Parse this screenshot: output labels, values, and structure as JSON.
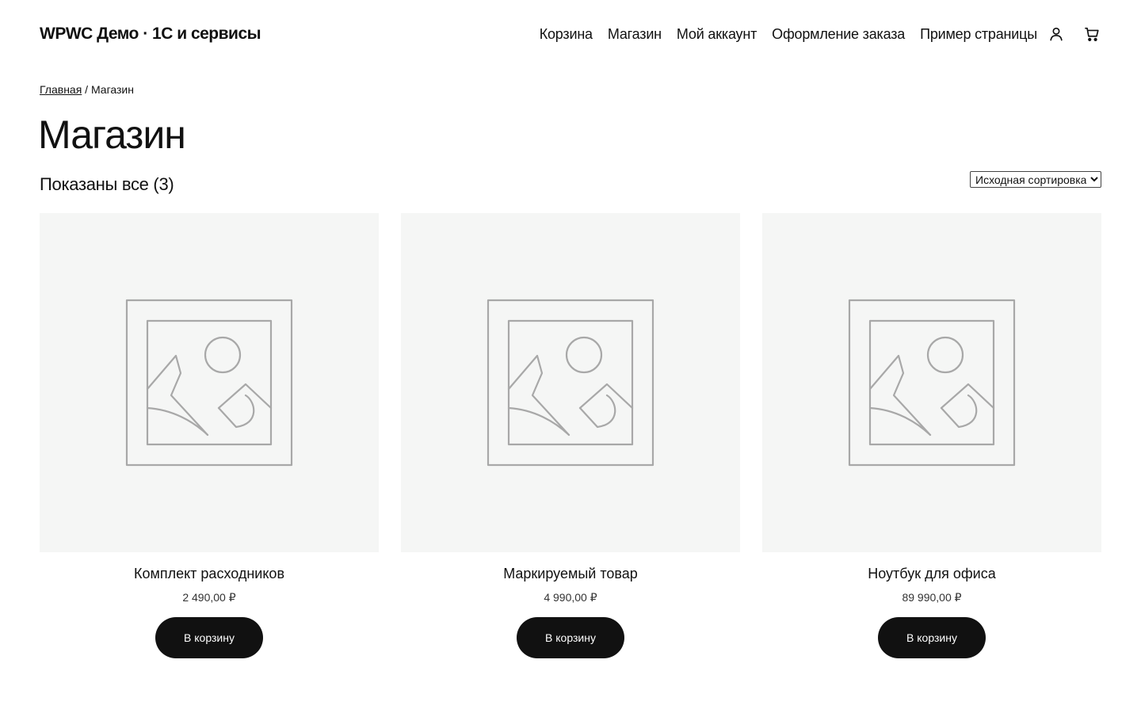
{
  "site": {
    "title": "WPWC Демо · 1С и сервисы"
  },
  "nav": {
    "items": [
      {
        "label": "Корзина"
      },
      {
        "label": "Магазин"
      },
      {
        "label": "Мой аккаунт"
      },
      {
        "label": "Оформление заказа"
      },
      {
        "label": "Пример страницы"
      }
    ],
    "account_icon": "user-icon",
    "cart_icon": "cart-icon"
  },
  "breadcrumb": {
    "home": "Главная",
    "separator": " / ",
    "current": "Магазин"
  },
  "page": {
    "title": "Магазин",
    "result_count": "Показаны все (3)"
  },
  "sort": {
    "selected": "Исходная сортировка"
  },
  "products": [
    {
      "title": "Комплект расходников",
      "price": "2 490,00 ₽",
      "button": "В корзину",
      "image_icon": "image-placeholder-icon"
    },
    {
      "title": "Маркируемый товар",
      "price": "4 990,00 ₽",
      "button": "В корзину",
      "image_icon": "image-placeholder-icon"
    },
    {
      "title": "Ноутбук для офиса",
      "price": "89 990,00 ₽",
      "button": "В корзину",
      "image_icon": "image-placeholder-icon"
    }
  ],
  "colors": {
    "text": "#111111",
    "button_bg": "#111111",
    "button_text": "#ffffff",
    "image_bg": "#f5f6f5",
    "placeholder_stroke": "#a8a8a8"
  }
}
